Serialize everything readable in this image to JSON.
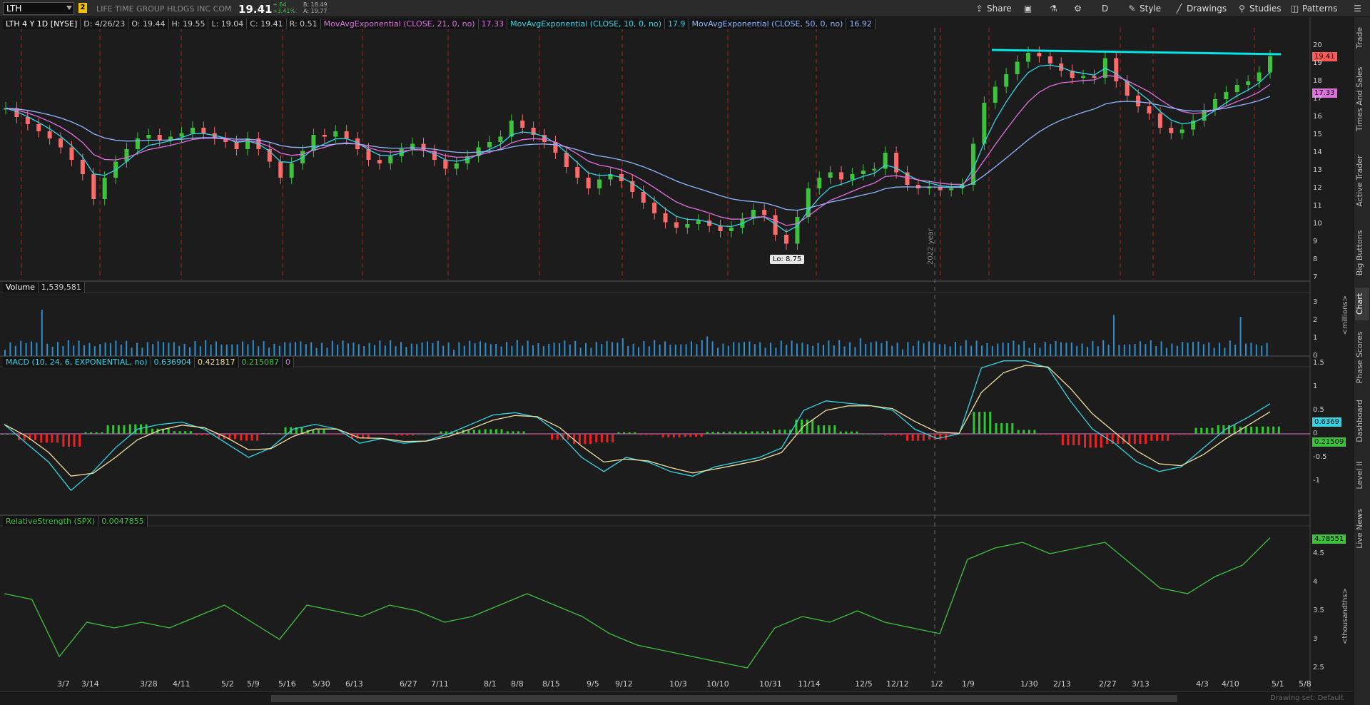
{
  "topbar": {
    "symbol": "LTH",
    "link_number": "2",
    "company": "LIFE TIME GROUP HLDGS INC COM",
    "last": "19.41",
    "change": "+.64",
    "change_pct": "+3.41%",
    "bid": "B: 18.49",
    "ask": "A: 19.77",
    "buttons": {
      "share": "Share",
      "style": "Style",
      "drawings": "Drawings",
      "studies": "Studies",
      "patterns": "Patterns",
      "period": "D"
    }
  },
  "price_pane": {
    "title": "LTH 4 Y 1D [NYSE]",
    "date": "D: 4/26/23",
    "open": "O: 19.44",
    "high": "H: 19.55",
    "low": "L: 19.04",
    "close": "C: 19.41",
    "range": "R: 0.51",
    "ema21_label": "MovAvgExponential (CLOSE, 21, 0, no)",
    "ema21_val": "17.33",
    "ema10_label": "MovAvgExponential (CLOSE, 10, 0, no)",
    "ema10_val": "17.9",
    "ema50_label": "MovAvgExponential (CLOSE, 50, 0, no)",
    "ema50_val": "16.92",
    "last_badge": "19.41",
    "ema_badge": "17.33",
    "low_marker": "Lo: 8.75",
    "year_marker": "2022 year",
    "y_ticks": [
      "20",
      "19",
      "18",
      "17",
      "16",
      "15",
      "14",
      "13",
      "12",
      "11",
      "10",
      "9",
      "8",
      "7"
    ],
    "colors": {
      "up": "#3ec23e",
      "down": "#ff6b6b",
      "ema10": "#33d6e6",
      "ema21": "#e070e0",
      "ema50": "#8fb6ff",
      "trendline": "#00e5e5"
    }
  },
  "volume_pane": {
    "title": "Volume",
    "value": "1,539,581",
    "y_ticks": [
      "3",
      "2",
      "1",
      "0"
    ],
    "unit": "<millions>"
  },
  "macd_pane": {
    "title": "MACD (10, 24, 6, EXPONENTIAL, no)",
    "v1": "0.636904",
    "v2": "0.421817",
    "v3": "0.215087",
    "v4": "0",
    "y_ticks": [
      "1.5",
      "1",
      "0.5",
      "0",
      "-0.5",
      "-1"
    ],
    "badge_macd": "0.6369",
    "badge_hist": "0.21509"
  },
  "rs_pane": {
    "title": "RelativeStrength (SPX)",
    "value": "0.0047855",
    "y_ticks": [
      "4.5",
      "4",
      "3.5",
      "3",
      "2.5"
    ],
    "unit": "<thousandths>",
    "badge": "4.78551"
  },
  "x_axis": [
    "3/7",
    "3/14",
    "3/28",
    "4/11",
    "5/2",
    "5/9",
    "5/16",
    "5/30",
    "6/13",
    "6/27",
    "7/11",
    "8/1",
    "8/8",
    "8/15",
    "9/5",
    "9/12",
    "10/3",
    "10/10",
    "10/31",
    "11/14",
    "12/5",
    "12/12",
    "1/2",
    "1/9",
    "1/30",
    "2/13",
    "2/27",
    "3/13",
    "4/3",
    "4/10",
    "5/1",
    "5/8"
  ],
  "right_tabs": [
    "Trade",
    "Times And Sales",
    "Active Trader",
    "Big Buttons",
    "Chart",
    "Phase Scores",
    "Dashboard",
    "Level II",
    "Live News"
  ],
  "footer": {
    "drawing_set": "Drawing set: Default"
  },
  "chart_data": {
    "type": "line",
    "series": [
      {
        "name": "RelativeStrength (SPX)",
        "values": [
          3.8,
          3.7,
          2.7,
          3.3,
          3.2,
          3.3,
          3.2,
          3.4,
          3.6,
          3.3,
          3.0,
          3.6,
          3.5,
          3.4,
          3.6,
          3.5,
          3.3,
          3.4,
          3.6,
          3.8,
          3.6,
          3.4,
          3.1,
          2.9,
          2.8,
          2.7,
          2.6,
          2.5,
          3.2,
          3.4,
          3.3,
          3.5,
          3.3,
          3.2,
          3.1,
          4.4,
          4.6,
          4.7,
          4.5,
          4.6,
          4.7,
          4.3,
          3.9,
          3.8,
          4.1,
          4.3,
          4.78
        ]
      }
    ]
  }
}
